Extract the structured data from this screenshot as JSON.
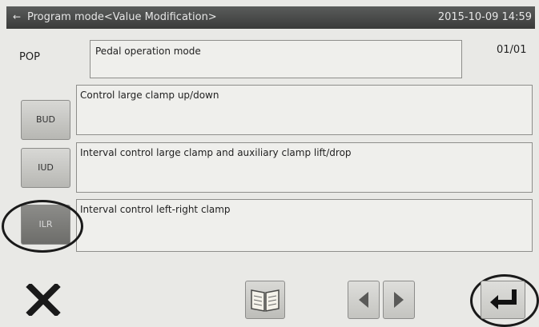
{
  "titlebar": {
    "icon": "back-arrow-icon",
    "title": "Program mode<Value Modification>",
    "datetime": "2015-10-09 14:59"
  },
  "parameter": {
    "code": "POP",
    "description": "Pedal operation mode",
    "page": "01/01"
  },
  "options": [
    {
      "code": "BUD",
      "description": "Control large clamp up/down",
      "selected": false
    },
    {
      "code": "IUD",
      "description": "Interval control large clamp and auxiliary clamp lift/drop",
      "selected": false
    },
    {
      "code": "ILR",
      "description": "Interval control left-right clamp",
      "selected": true
    }
  ],
  "bottom_bar": {
    "close_icon": "close-x-icon",
    "manual_icon": "open-book-icon",
    "prev_icon": "left-arrow-icon",
    "next_icon": "right-arrow-icon",
    "enter_icon": "enter-return-icon"
  },
  "colors": {
    "titlebar": "#4a4b4a",
    "selected_button": "#7a7a77"
  }
}
